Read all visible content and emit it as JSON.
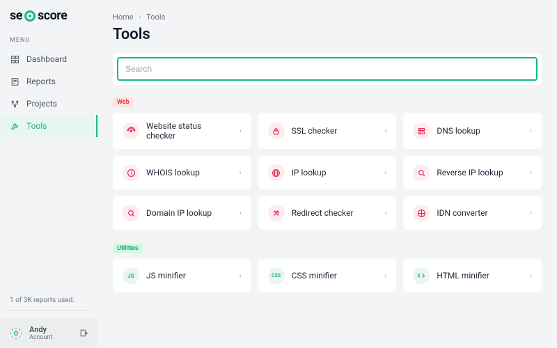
{
  "logo": {
    "pre": "se",
    "post": "score"
  },
  "menu_label": "MENU",
  "nav": [
    {
      "label": "Dashboard",
      "icon": "dashboard"
    },
    {
      "label": "Reports",
      "icon": "reports"
    },
    {
      "label": "Projects",
      "icon": "projects"
    },
    {
      "label": "Tools",
      "icon": "tools"
    }
  ],
  "usage_text": "1 of 3K reports used.",
  "account": {
    "name": "Andy",
    "label": "Account"
  },
  "breadcrumb": {
    "home": "Home",
    "current": "Tools"
  },
  "page_title": "Tools",
  "search": {
    "placeholder": "Search"
  },
  "sections": {
    "web": {
      "badge": "Web",
      "items": [
        {
          "label": "Website status checker",
          "icon": "status"
        },
        {
          "label": "SSL checker",
          "icon": "lock"
        },
        {
          "label": "DNS lookup",
          "icon": "dns"
        },
        {
          "label": "WHOIS lookup",
          "icon": "info"
        },
        {
          "label": "IP lookup",
          "icon": "globe"
        },
        {
          "label": "Reverse IP lookup",
          "icon": "search"
        },
        {
          "label": "Domain IP lookup",
          "icon": "search"
        },
        {
          "label": "Redirect checker",
          "icon": "redirect"
        },
        {
          "label": "IDN converter",
          "icon": "idn"
        }
      ]
    },
    "utilities": {
      "badge": "Utilities",
      "items": [
        {
          "label": "JS minifier",
          "icon": "js"
        },
        {
          "label": "CSS minifier",
          "icon": "css"
        },
        {
          "label": "HTML minifier",
          "icon": "html"
        }
      ]
    }
  }
}
